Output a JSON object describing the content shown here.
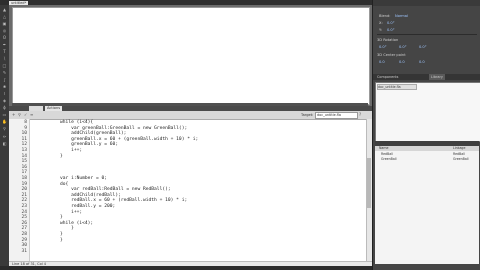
{
  "document_tab": "untitled*",
  "actions_panel": {
    "title": "Actions",
    "target_label": "Target:",
    "target_value": "doc_untitle.fla",
    "status": "Line 18 of 31, Col 4",
    "line_numbers": [
      "8",
      "9",
      "10",
      "11",
      "12",
      "13",
      "14",
      "15",
      "16",
      "17",
      "18",
      "19",
      "20",
      "21",
      "22",
      "23",
      "24",
      "25",
      "26",
      "27",
      "28",
      "29",
      "30",
      "31"
    ],
    "code_lines": [
      "while (i<4){",
      "    var greenBall:GreenBall = new GreenBall();",
      "    addChild(greenBall);",
      "    greenBall.x = 60 + (greenBall.width + 10) * i;",
      "    greenBall.y = 60;",
      "    i++;",
      "}",
      "",
      "",
      "",
      "var i:Number = 0;",
      "do{",
      "    var redBall:RedBall = new RedBall();",
      "    addChild(redBall);",
      "    redBall.x = 60 + (redBall.width + 10) * i;",
      "    redBall.y = 200;",
      "    i++;",
      "}",
      "while (i<4);",
      "    }",
      "}",
      "}",
      "",
      ""
    ]
  },
  "properties_panel": {
    "blend_label": "Blend:",
    "blend_value": "Normal",
    "x_label": "X:",
    "x_value": "0.0°",
    "y_label": "Y:",
    "y_value": "0.0°",
    "section_3d_rotation": "3D Rotation",
    "rx_value": "0.0°",
    "ry_value": "0.0°",
    "rz_value": "0.0°",
    "section_3d_center": "3D Center point",
    "cx_value": "0.0",
    "cy_value": "0.0",
    "cz_value": "0.0"
  },
  "library_panel": {
    "tabs": [
      "Components",
      "Library"
    ],
    "doc_select": "doc_untitle.fla",
    "items_header": "Name",
    "linkage_header": "Linkage",
    "items": [
      {
        "name": "RedBall",
        "linkage": "RedBall"
      },
      {
        "name": "GreenBall",
        "linkage": "GreenBall"
      }
    ]
  },
  "colors": {
    "chrome": "#3b3b3b",
    "stage": "#ffffff",
    "code_text": "#222222"
  }
}
